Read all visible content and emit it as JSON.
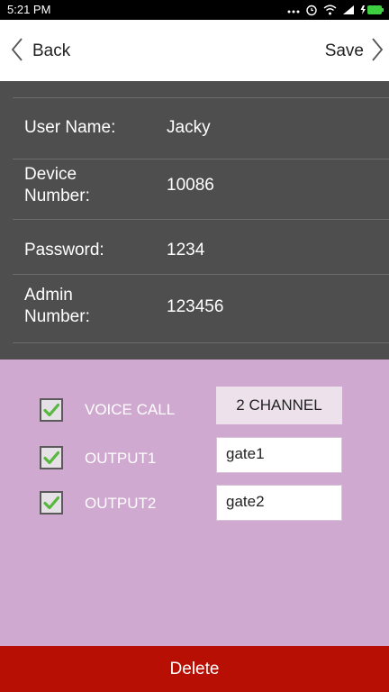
{
  "status_bar": {
    "time": "5:21 PM",
    "icons": [
      "more-dots-icon",
      "alarm-icon",
      "wifi-icon",
      "signal-icon",
      "battery-charging-icon"
    ]
  },
  "header": {
    "back_label": "Back",
    "save_label": "Save"
  },
  "info": {
    "fields": [
      {
        "label": "User Name:",
        "value": "Jacky"
      },
      {
        "label_line1": "Device",
        "label_line2": "Number:",
        "value": "10086"
      },
      {
        "label": "Password:",
        "value": "1234"
      },
      {
        "label_line1": "Admin",
        "label_line2": "Number:",
        "value": "123456"
      }
    ]
  },
  "options": {
    "voice_call": {
      "label": "VOICE CALL",
      "checked": true,
      "channel": "2 CHANNEL"
    },
    "output1": {
      "label": "OUTPUT1",
      "checked": true,
      "value": "gate1"
    },
    "output2": {
      "label": "OUTPUT2",
      "checked": true,
      "value": "gate2"
    }
  },
  "footer": {
    "delete_label": "Delete"
  },
  "colors": {
    "info_panel_bg": "#4e4e4e",
    "options_panel_bg": "#cfa9cf",
    "delete_bg": "#b70f04",
    "checkmark": "#56b83c"
  }
}
